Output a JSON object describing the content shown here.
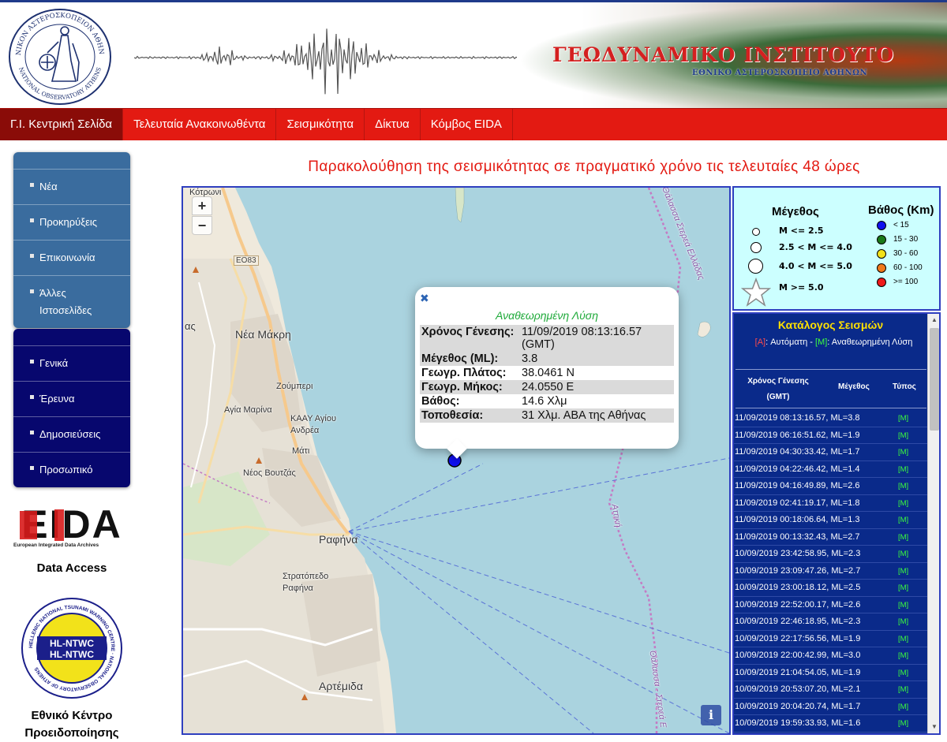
{
  "header": {
    "institute_title": "ΓΕΩΔΥΝΑΜΙΚΟ ΙΝΣΤΙΤΟΥΤΟ",
    "institute_subtitle": "ΕΘΝΙΚΟ ΑΣΤΕΡΟΣΚΟΠΕΙΟ ΑΘΗΝΩΝ",
    "seal_text_top": "ΕΘΝΙΚΟΝ ΑΣΤΕΡΟΣΚΟΠΕΙΟΝ ΑΘΗΝΩΝ",
    "seal_text_bottom": "NATIONAL OBSERVATORY ATHENS"
  },
  "nav": {
    "items": [
      {
        "label": "Γ.Ι. Κεντρική Σελίδα",
        "active": true
      },
      {
        "label": "Τελευταία Ανακοινωθέντα",
        "active": false
      },
      {
        "label": "Σεισμικότητα",
        "active": false
      },
      {
        "label": "Δίκτυα",
        "active": false
      },
      {
        "label": "Κόμβος EIDA",
        "active": false
      }
    ]
  },
  "sidebar": {
    "box1": [
      "Νέα",
      "Προκηρύξεις",
      "Επικοινωνία",
      "Άλλες Ιστοσελίδες"
    ],
    "box2": [
      "Γενικά",
      "Έρευνα",
      "Δημοσιεύσεις",
      "Προσωπικό"
    ],
    "eida_logo_text": "EIDA",
    "eida_caption": "European Integrated Data Archives",
    "data_access": "Data Access",
    "tsunami_logo_text_1": "HL-NTWC",
    "tsunami_logo_text_2": "HL-NTWC",
    "tsunami_ring_text": "HELLENIC NATIONAL TSUNAMI WARNING CENTRE · NATIONAL OBSERVATORY OF ATHENS",
    "tsunami_title": "Εθνικό Κέντρο Προειδοποίησης"
  },
  "main": {
    "heading": "Παρακολούθηση της σεισμικότητας σε πραγματικό χρόνο τις τελευταίες 48 ώρες"
  },
  "map": {
    "zoom_in": "+",
    "zoom_out": "−",
    "info": "i",
    "labels": {
      "kotroni": "Κότρωνι",
      "eo83": "ΕΟ83",
      "aas": "ας",
      "nea_makri": "Νέα Μάκρη",
      "zoumperi": "Ζούμπερι",
      "agia_marina": "Αγία Μαρίνα",
      "kaay": "ΚΑΑΥ Αγίου Ανδρέα",
      "mati": "Μάτι",
      "neos_voutzas": "Νέος Βουτζάς",
      "rafina": "Ραφήνα",
      "stratopedo": "Στρατόπεδο Ραφήνα",
      "artemida": "Αρτέμιδα",
      "sea_top": "Θάλασσα Στερεά Ελλάδας",
      "attiki": "Αττική",
      "sea_bottom": "Θάλασσα - Στερεά Ε"
    },
    "popup": {
      "close": "✖",
      "title": "Αναθεωρημένη Λύση",
      "rows": [
        {
          "key": "Χρόνος Γένεσης:",
          "value": "11/09/2019 08:13:16.57 (GMT)"
        },
        {
          "key": "Μέγεθος (ML):",
          "value": "3.8"
        },
        {
          "key": "Γεωγρ. Πλάτος:",
          "value": "38.0461 N"
        },
        {
          "key": "Γεωγρ. Μήκος:",
          "value": "24.0550 E"
        },
        {
          "key": "Βάθος:",
          "value": "14.6 Χλμ"
        },
        {
          "key": "Τοποθεσία:",
          "value": "31 Χλμ. ΑΒΑ της Αθήνας"
        }
      ]
    }
  },
  "legend": {
    "magnitude_title": "Μέγεθος",
    "depth_title": "Βάθος (Km)",
    "magnitudes": [
      "M <= 2.5",
      "2.5 < M <= 4.0",
      "4.0 < M <= 5.0",
      "M >= 5.0"
    ],
    "depths": [
      {
        "label": "< 15",
        "color": "#1010ee"
      },
      {
        "label": "15 - 30",
        "color": "#1a7a1a"
      },
      {
        "label": "30 - 60",
        "color": "#f2e21a"
      },
      {
        "label": "60 - 100",
        "color": "#f0781a"
      },
      {
        "label": ">= 100",
        "color": "#ee1a1a"
      }
    ]
  },
  "catalog": {
    "title": "Κατάλογος Σεισμών",
    "tag_a": "[A]",
    "auto_label": ": Αυτόματη -",
    "tag_m": "[M]",
    "revised_label": ": Αναθεωρημένη Λύση",
    "col_time": "Χρόνος Γένεσης (GMT)",
    "col_mag": "Μέγεθος",
    "col_type": "Τύπος",
    "rows": [
      {
        "event": "11/09/2019 08:13:16.57, ML=3.8",
        "type": "[M]"
      },
      {
        "event": "11/09/2019 06:16:51.62, ML=1.9",
        "type": "[M]"
      },
      {
        "event": "11/09/2019 04:30:33.42, ML=1.7",
        "type": "[M]"
      },
      {
        "event": "11/09/2019 04:22:46.42, ML=1.4",
        "type": "[M]"
      },
      {
        "event": "11/09/2019 04:16:49.89, ML=2.6",
        "type": "[M]"
      },
      {
        "event": "11/09/2019 02:41:19.17, ML=1.8",
        "type": "[M]"
      },
      {
        "event": "11/09/2019 00:18:06.64, ML=1.3",
        "type": "[M]"
      },
      {
        "event": "11/09/2019 00:13:32.43, ML=2.7",
        "type": "[M]"
      },
      {
        "event": "10/09/2019 23:42:58.95, ML=2.3",
        "type": "[M]"
      },
      {
        "event": "10/09/2019 23:09:47.26, ML=2.7",
        "type": "[M]"
      },
      {
        "event": "10/09/2019 23:00:18.12, ML=2.5",
        "type": "[M]"
      },
      {
        "event": "10/09/2019 22:52:00.17, ML=2.6",
        "type": "[M]"
      },
      {
        "event": "10/09/2019 22:46:18.95, ML=2.3",
        "type": "[M]"
      },
      {
        "event": "10/09/2019 22:17:56.56, ML=1.9",
        "type": "[M]"
      },
      {
        "event": "10/09/2019 22:00:42.99, ML=3.0",
        "type": "[M]"
      },
      {
        "event": "10/09/2019 21:04:54.05, ML=1.9",
        "type": "[M]"
      },
      {
        "event": "10/09/2019 20:53:07.20, ML=2.1",
        "type": "[M]"
      },
      {
        "event": "10/09/2019 20:04:20.74, ML=1.7",
        "type": "[M]"
      },
      {
        "event": "10/09/2019 19:59:33.93, ML=1.6",
        "type": "[M]"
      }
    ]
  },
  "colors": {
    "nav_red": "#e31a12",
    "nav_active": "#8a0c08",
    "sidebar_blue": "#3a6c9e",
    "sidebar_navy": "#07076e",
    "catalog_bg": "#0a2a8a",
    "legend_bg": "#ccffff",
    "sea": "#aad3df",
    "event_marker": "#1010ee"
  }
}
